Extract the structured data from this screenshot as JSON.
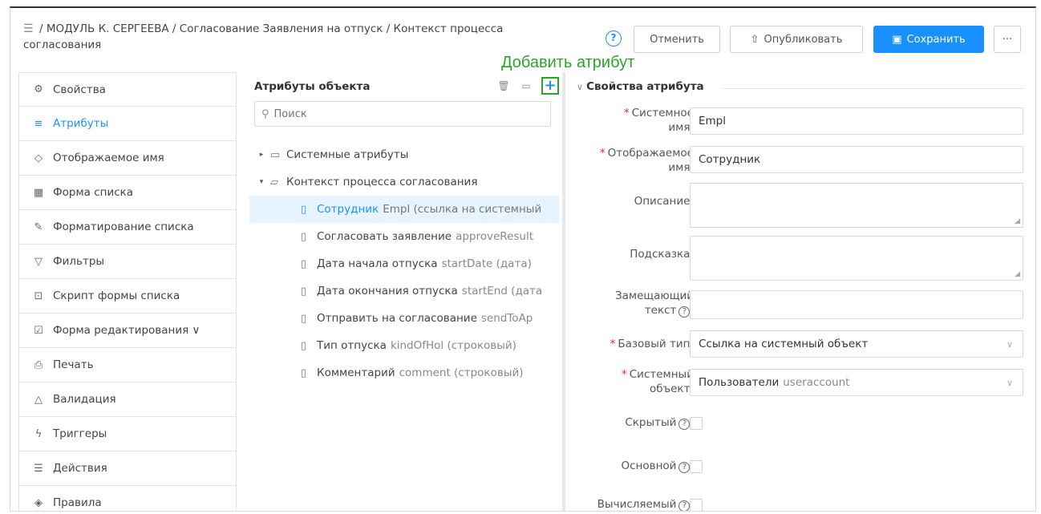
{
  "header": {
    "breadcrumb_line1": "/ МОДУЛЬ К. СЕРГЕЕВА / Согласование Заявления на отпуск / Контекст процесса",
    "breadcrumb_line2": "согласования",
    "help": "?",
    "cancel": "Отменить",
    "publish": "Опубликовать",
    "save": "Сохранить",
    "more": "···"
  },
  "annotation": "Добавить атрибут",
  "sidebar": {
    "items": [
      {
        "label": "Свойства",
        "icon": "gear-icon"
      },
      {
        "label": "Атрибуты",
        "icon": "list-icon",
        "active": true
      },
      {
        "label": "Отображаемое имя",
        "icon": "tag-icon"
      },
      {
        "label": "Форма списка",
        "icon": "table-icon"
      },
      {
        "label": "Форматирование списка",
        "icon": "brush-icon"
      },
      {
        "label": "Фильтры",
        "icon": "filter-icon"
      },
      {
        "label": "Скрипт формы списка",
        "icon": "script-icon"
      },
      {
        "label": "Форма редактирования ∨",
        "icon": "edit-icon"
      },
      {
        "label": "Печать",
        "icon": "print-icon"
      },
      {
        "label": "Валидация",
        "icon": "warning-icon"
      },
      {
        "label": "Триггеры",
        "icon": "bolt-icon"
      },
      {
        "label": "Действия",
        "icon": "menu-icon"
      },
      {
        "label": "Правила",
        "icon": "rules-icon"
      }
    ]
  },
  "attributes": {
    "title": "Атрибуты объекта",
    "search_placeholder": "Поиск",
    "tree": [
      {
        "name": "Системные атрибуты",
        "code": "",
        "folder": true,
        "open": false
      },
      {
        "name": "Контекст процесса согласования",
        "code": "",
        "folder": true,
        "open": true
      },
      {
        "name": "Сотрудник",
        "code": "Empl (ссылка на системный",
        "selected": true
      },
      {
        "name": "Согласовать заявление",
        "code": "approveResult"
      },
      {
        "name": "Дата начала отпуска",
        "code": "startDate (дата)"
      },
      {
        "name": "Дата окончания отпуска",
        "code": "startEnd (дата"
      },
      {
        "name": "Отправить на согласование",
        "code": "sendToAp"
      },
      {
        "name": "Тип отпуска",
        "code": "kindOfHol (строковый)"
      },
      {
        "name": "Комментарий",
        "code": "comment (строковый)"
      }
    ]
  },
  "props": {
    "title": "Свойства атрибута",
    "system_name_label": [
      "Системное",
      "имя:"
    ],
    "system_name_value": "Empl",
    "display_name_label": [
      "Отображаемое",
      "имя:"
    ],
    "display_name_value": "Сотрудник",
    "description_label": "Описание:",
    "hint_label": "Подсказка:",
    "placeholder_label": [
      "Замещающий",
      "текст"
    ],
    "base_type_label": "Базовый тип:",
    "base_type_value": "Ссылка на системный объект",
    "system_object_label": [
      "Системный",
      "объект:"
    ],
    "system_object_value": "Пользователи",
    "system_object_code": "useraccount",
    "hidden_label": "Скрытый",
    "main_label": "Основной",
    "computed_label": "Вычисляемый"
  }
}
